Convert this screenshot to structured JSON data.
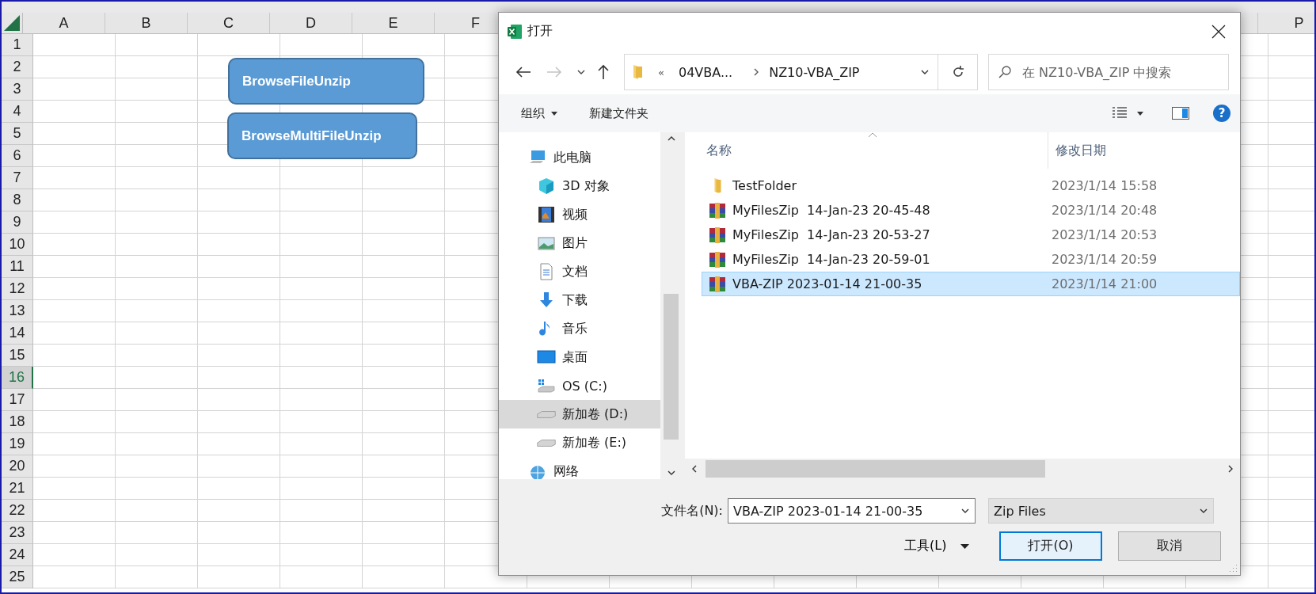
{
  "sheet": {
    "columns": [
      {
        "label": "A"
      },
      {
        "label": "B"
      },
      {
        "label": "C"
      },
      {
        "label": "D"
      },
      {
        "label": "E"
      },
      {
        "label": "F"
      },
      {
        "label": "P"
      }
    ],
    "rows": [
      {
        "label": "1",
        "selected": false
      },
      {
        "label": "2",
        "selected": false
      },
      {
        "label": "3",
        "selected": false
      },
      {
        "label": "4",
        "selected": false
      },
      {
        "label": "5",
        "selected": false
      },
      {
        "label": "6",
        "selected": false
      },
      {
        "label": "7",
        "selected": false
      },
      {
        "label": "8",
        "selected": false
      },
      {
        "label": "9",
        "selected": false
      },
      {
        "label": "10",
        "selected": false
      },
      {
        "label": "11",
        "selected": false
      },
      {
        "label": "12",
        "selected": false
      },
      {
        "label": "13",
        "selected": false
      },
      {
        "label": "14",
        "selected": false
      },
      {
        "label": "15",
        "selected": false
      },
      {
        "label": "16",
        "selected": true
      },
      {
        "label": "17",
        "selected": false
      },
      {
        "label": "18",
        "selected": false
      },
      {
        "label": "19",
        "selected": false
      },
      {
        "label": "20",
        "selected": false
      },
      {
        "label": "21",
        "selected": false
      },
      {
        "label": "22",
        "selected": false
      },
      {
        "label": "23",
        "selected": false
      },
      {
        "label": "24",
        "selected": false
      },
      {
        "label": "25",
        "selected": false
      }
    ],
    "shapes": [
      {
        "label": "BrowseFileUnzip"
      },
      {
        "label": "BrowseMultiFileUnzip"
      }
    ]
  },
  "dialog": {
    "title": "打开",
    "history": {
      "back_disabled": false,
      "forward_disabled": true
    },
    "address": {
      "prefix": "«",
      "segments": [
        "04VBA...",
        "NZ10-VBA_ZIP"
      ]
    },
    "search": {
      "placeholder": "在 NZ10-VBA_ZIP 中搜索"
    },
    "toolbar": {
      "organize": "组织",
      "new_folder": "新建文件夹",
      "help": "?"
    },
    "nav": [
      {
        "label": "此电脑",
        "kind": "computer",
        "selected": false,
        "children": [
          {
            "label": "3D 对象",
            "kind": "cube",
            "selected": false
          },
          {
            "label": "视频",
            "kind": "video",
            "selected": false
          },
          {
            "label": "图片",
            "kind": "picture",
            "selected": false
          },
          {
            "label": "文档",
            "kind": "document",
            "selected": false
          },
          {
            "label": "下载",
            "kind": "download",
            "selected": false
          },
          {
            "label": "音乐",
            "kind": "music",
            "selected": false
          },
          {
            "label": "桌面",
            "kind": "desktop",
            "selected": false
          },
          {
            "label": "OS (C:)",
            "kind": "system-drive",
            "selected": false
          },
          {
            "label": "新加卷 (D:)",
            "kind": "drive",
            "selected": true
          },
          {
            "label": "新加卷 (E:)",
            "kind": "drive",
            "selected": false
          }
        ]
      },
      {
        "label": "网络",
        "kind": "network",
        "selected": false
      }
    ],
    "columns": [
      "名称",
      "修改日期"
    ],
    "files": [
      {
        "name": "TestFolder",
        "date": "2023/1/14 15:58",
        "kind": "folder",
        "selected": false
      },
      {
        "name": "MyFilesZip  14-Jan-23 20-45-48",
        "date": "2023/1/14 20:48",
        "kind": "archive",
        "selected": false
      },
      {
        "name": "MyFilesZip  14-Jan-23 20-53-27",
        "date": "2023/1/14 20:53",
        "kind": "archive",
        "selected": false
      },
      {
        "name": "MyFilesZip  14-Jan-23 20-59-01",
        "date": "2023/1/14 20:59",
        "kind": "archive",
        "selected": false
      },
      {
        "name": "VBA-ZIP 2023-01-14 21-00-35",
        "date": "2023/1/14 21:00",
        "kind": "archive",
        "selected": true
      }
    ],
    "filename_label": "文件名(N):",
    "filename": "VBA-ZIP 2023-01-14 21-00-35",
    "filter": "Zip Files",
    "tools": "工具(L)",
    "buttons": [
      {
        "label": "打开(O)",
        "default": true
      },
      {
        "label": "取消",
        "default": false
      }
    ]
  }
}
